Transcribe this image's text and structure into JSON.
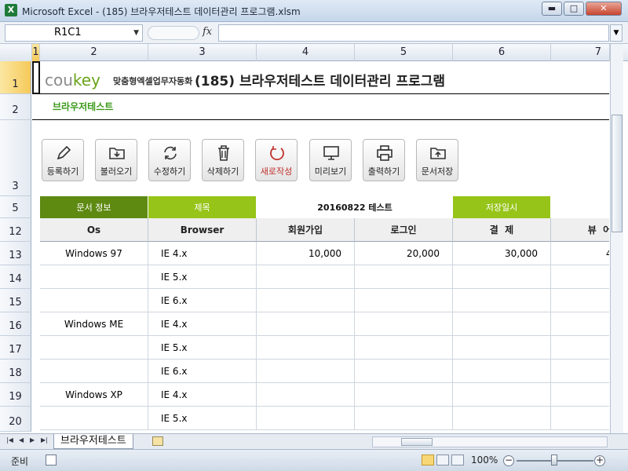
{
  "window": {
    "app_icon": "excel-icon",
    "title": "Microsoft Excel - (185) 브라우저테스트 데이터관리 프로그램.xlsm",
    "buttons": [
      "minimize-icon",
      "maximize-icon",
      "close-icon"
    ]
  },
  "formula_bar": {
    "name_box": "R1C1",
    "fx_label": "fx",
    "formula": ""
  },
  "columns": [
    "1",
    "2",
    "3",
    "4",
    "5",
    "6",
    "7"
  ],
  "rows": [
    "1",
    "2",
    "3",
    "5",
    "12",
    "13",
    "14",
    "15",
    "16",
    "17",
    "18",
    "19",
    "20"
  ],
  "sheet": {
    "logo_main": "cou",
    "logo_accent": "key",
    "logo_sub": "맞춤형엑셀업무자동화",
    "title": "(185) 브라우저테스트 데이터관리 프로그램",
    "subtitle": "브라우저테스트",
    "toolbar": [
      {
        "label": "등록하기",
        "icon": "pencil-icon"
      },
      {
        "label": "불러오기",
        "icon": "folder-download-icon"
      },
      {
        "label": "수정하기",
        "icon": "refresh-icon"
      },
      {
        "label": "삭제하기",
        "icon": "trash-icon"
      },
      {
        "label": "새로작성",
        "icon": "new-circle-icon"
      },
      {
        "label": "미리보기",
        "icon": "monitor-icon"
      },
      {
        "label": "출력하기",
        "icon": "printer-icon"
      },
      {
        "label": "문서저장",
        "icon": "folder-upload-icon"
      }
    ],
    "info_row": {
      "doc_info": "문서 정보",
      "title_label": "제목",
      "title_value": "20160822 테스트",
      "saved_label": "저장일시",
      "saved_value": ""
    },
    "table_headers": [
      "Os",
      "Browser",
      "회원가입",
      "로그인",
      "결  제",
      "뷰  어"
    ],
    "table_rows": [
      [
        "Windows 97",
        "IE 4.x",
        "10,000",
        "20,000",
        "30,000",
        "4"
      ],
      [
        "",
        "IE 5.x",
        "",
        "",
        "",
        ""
      ],
      [
        "",
        "IE 6.x",
        "",
        "",
        "",
        ""
      ],
      [
        "Windows ME",
        "IE 4.x",
        "",
        "",
        "",
        ""
      ],
      [
        "",
        "IE 5.x",
        "",
        "",
        "",
        ""
      ],
      [
        "",
        "IE 6.x",
        "",
        "",
        "",
        ""
      ],
      [
        "Windows XP",
        "IE 4.x",
        "",
        "",
        "",
        ""
      ],
      [
        "",
        "IE 5.x",
        "",
        "",
        "",
        ""
      ]
    ]
  },
  "tabs": {
    "active": "브라우저테스트"
  },
  "status": {
    "ready": "준비",
    "zoom": "100%"
  },
  "colors": {
    "dark_green": "#5e8a12",
    "light_green": "#96c418",
    "accent_text": "#3a9a18"
  }
}
